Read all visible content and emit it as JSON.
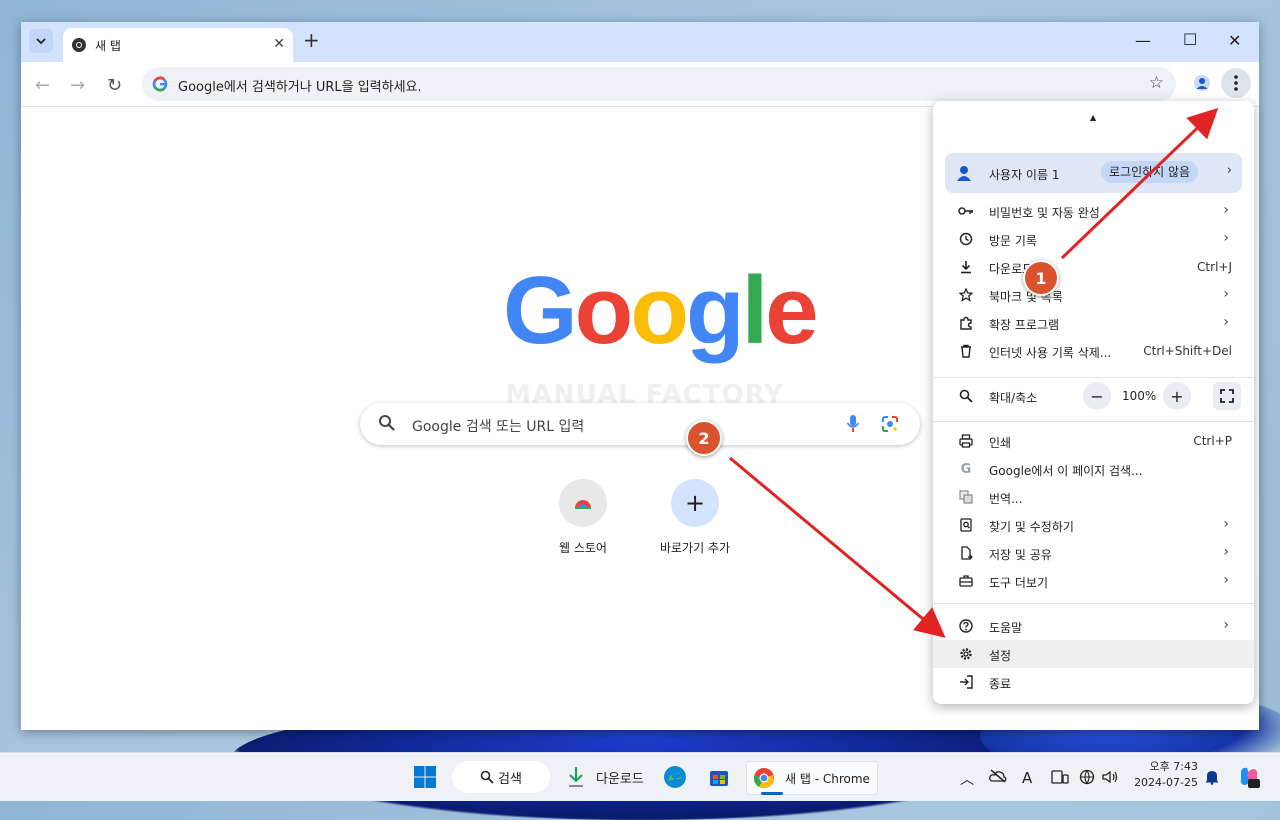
{
  "browser": {
    "tab_title": "새 탭",
    "omnibox_placeholder": "Google에서 검색하거나 URL을 입력하세요."
  },
  "ntp": {
    "logo": [
      "G",
      "o",
      "o",
      "g",
      "l",
      "e"
    ],
    "logo_colors": [
      "#4285f4",
      "#ea4335",
      "#fbbc05",
      "#4285f4",
      "#34a853",
      "#ea4335"
    ],
    "watermark": "MANUAL FACTORY",
    "search_placeholder": "Google 검색 또는 URL 입력",
    "shortcuts": [
      {
        "label": "웹 스토어",
        "icon": "chrome-web-store-icon"
      },
      {
        "label": "바로가기 추가",
        "icon": "plus-icon"
      }
    ]
  },
  "menu": {
    "profile": {
      "name": "사용자 이름 1",
      "status": "로그인하지 않음"
    },
    "group1": [
      {
        "label": "비밀번호 및 자동 완성",
        "icon": "key-icon",
        "submenu": true
      },
      {
        "label": "방문 기록",
        "icon": "history-icon",
        "submenu": true
      },
      {
        "label": "다운로드",
        "icon": "download-icon",
        "shortcut": "Ctrl+J"
      },
      {
        "label": "북마크 및 목록",
        "icon": "star-icon",
        "submenu": true
      },
      {
        "label": "확장 프로그램",
        "icon": "extension-icon",
        "submenu": true
      },
      {
        "label": "인터넷 사용 기록 삭제...",
        "icon": "trash-icon",
        "shortcut": "Ctrl+Shift+Del"
      }
    ],
    "zoom": {
      "label": "확대/축소",
      "value": "100%",
      "minus": "−",
      "plus": "+"
    },
    "group2": [
      {
        "label": "인쇄",
        "icon": "printer-icon",
        "shortcut": "Ctrl+P"
      },
      {
        "label": "Google에서 이 페이지 검색...",
        "icon": "google-g-icon"
      },
      {
        "label": "번역...",
        "icon": "translate-icon"
      },
      {
        "label": "찾기 및 수정하기",
        "icon": "find-icon",
        "submenu": true
      },
      {
        "label": "저장 및 공유",
        "icon": "save-share-icon",
        "submenu": true
      },
      {
        "label": "도구 더보기",
        "icon": "toolbox-icon",
        "submenu": true
      }
    ],
    "group3": [
      {
        "label": "도움말",
        "icon": "help-icon",
        "submenu": true
      },
      {
        "label": "설정",
        "icon": "gear-icon"
      },
      {
        "label": "종료",
        "icon": "exit-icon"
      }
    ]
  },
  "callouts": [
    "1",
    "2"
  ],
  "taskbar": {
    "search_label": "검색",
    "downloads_label": "다운로드",
    "chrome_label": "새 탭 - Chrome",
    "time": "오후 7:43",
    "date": "2024-07-25",
    "ime": "A"
  }
}
